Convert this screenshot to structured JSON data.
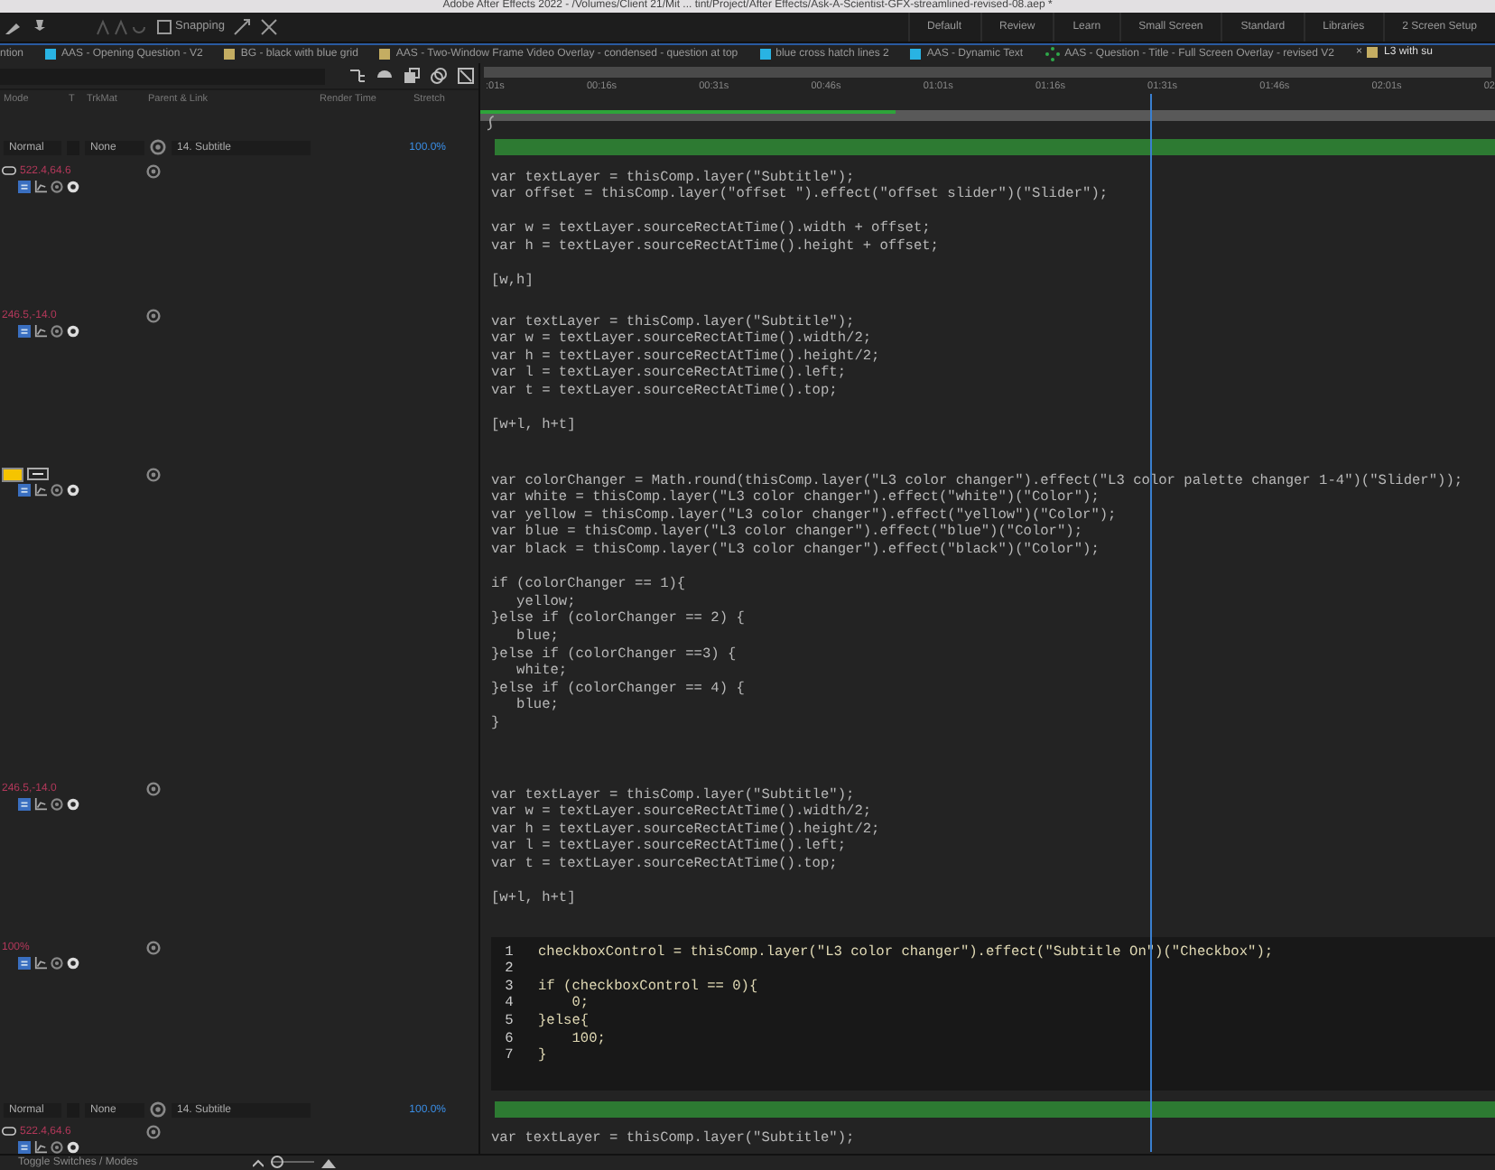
{
  "window": {
    "title": "Adobe After Effects 2022 - /Volumes/Client 21/Mit ... tint/Project/After Effects/Ask-A-Scientist-GFX-streamlined-revised-08.aep *"
  },
  "toolbar": {
    "snapping": {
      "label": "Snapping",
      "checked": false
    },
    "workspaces": [
      {
        "label": "Default",
        "selected": false
      },
      {
        "label": "Review",
        "selected": false
      },
      {
        "label": "Learn",
        "selected": false
      },
      {
        "label": "Small Screen",
        "selected": false
      },
      {
        "label": "Standard",
        "selected": false
      },
      {
        "label": "Libraries",
        "selected": false
      },
      {
        "label": "2 Screen Setup",
        "selected": false
      }
    ]
  },
  "comp_tabs": [
    {
      "label": "ntion",
      "selected": false
    },
    {
      "label": "AAS - Opening Question - V2",
      "color": "#29b3e3",
      "kind": "square",
      "selected": false
    },
    {
      "label": "BG - black with blue grid",
      "color": "#c4ad62",
      "kind": "square",
      "selected": false
    },
    {
      "label": "AAS - Two-Window Frame Video Overlay - condensed - question at top",
      "color": "#c4ad62",
      "kind": "square",
      "selected": false
    },
    {
      "label": "blue cross hatch lines 2",
      "color": "#29b3e3",
      "kind": "square",
      "selected": false
    },
    {
      "label": "AAS - Dynamic Text",
      "color": "#29b3e3",
      "kind": "square",
      "selected": false
    },
    {
      "label": "AAS - Question - Title - Full Screen Overlay - revised V2",
      "color": "#2fa84a",
      "kind": "dots",
      "selected": false
    },
    {
      "label": "L3 with su",
      "close": "×",
      "color": "#c4ad62",
      "kind": "square",
      "selected": true
    }
  ],
  "columns": [
    "Mode",
    "T",
    "TrkMat",
    "Parent & Link",
    "Render Time",
    "Stretch"
  ],
  "ruler": {
    "ticks": [
      ":01s",
      "00:16s",
      "00:31s",
      "00:46s",
      "01:01s",
      "01:16s",
      "01:31s",
      "01:46s",
      "02:01s",
      "02"
    ],
    "cache": {
      "level": 0.41
    },
    "playhead": {
      "level": 0.66
    }
  },
  "tracks": [
    {
      "kind": "marker"
    },
    {
      "kind": "layer",
      "mode": "Normal",
      "trkmat": "None",
      "parent": "14. Subtitle",
      "stretch": "100.0%"
    },
    {
      "kind": "property",
      "value": "522.4,64.6",
      "expression": "var textLayer = thisComp.layer(\"Subtitle\");\nvar offset = thisComp.layer(\"offset \").effect(\"offset slider\")(\"Slider\");\n\nvar w = textLayer.sourceRectAtTime().width + offset;\nvar h = textLayer.sourceRectAtTime().height + offset;\n\n[w,h]"
    },
    {
      "kind": "property",
      "value": "246.5,-14.0",
      "expression": "var textLayer = thisComp.layer(\"Subtitle\");\nvar w = textLayer.sourceRectAtTime().width/2;\nvar h = textLayer.sourceRectAtTime().height/2;\nvar l = textLayer.sourceRectAtTime().left;\nvar t = textLayer.sourceRectAtTime().top;\n\n[w+l, h+t]"
    },
    {
      "kind": "color",
      "color": "#f5c400",
      "expression": "var colorChanger = Math.round(thisComp.layer(\"L3 color changer\").effect(\"L3 color palette changer 1-4\")(\"Slider\"));\nvar white = thisComp.layer(\"L3 color changer\").effect(\"white\")(\"Color\");\nvar yellow = thisComp.layer(\"L3 color changer\").effect(\"yellow\")(\"Color\");\nvar blue = thisComp.layer(\"L3 color changer\").effect(\"blue\")(\"Color\");\nvar black = thisComp.layer(\"L3 color changer\").effect(\"black\")(\"Color\");\n\nif (colorChanger == 1){\n   yellow;\n}else if (colorChanger == 2) {\n   blue;\n}else if (colorChanger ==3) {\n   white;\n}else if (colorChanger == 4) {\n   blue;\n}"
    },
    {
      "kind": "property",
      "value": "246.5,-14.0",
      "expression": "var textLayer = thisComp.layer(\"Subtitle\");\nvar w = textLayer.sourceRectAtTime().width/2;\nvar h = textLayer.sourceRectAtTime().height/2;\nvar l = textLayer.sourceRectAtTime().left;\nvar t = textLayer.sourceRectAtTime().top;\n\n[w+l, h+t]"
    },
    {
      "kind": "editor",
      "value": "100%",
      "lines": [
        {
          "number": "1",
          "code": "checkboxControl = thisComp.layer(\"L3 color changer\").effect(\"Subtitle On\")(\"Checkbox\");"
        },
        {
          "number": "2"
        },
        {
          "number": "3",
          "code": "if (checkboxControl == 0){"
        },
        {
          "number": "4",
          "code": "    0;"
        },
        {
          "number": "5",
          "code": "}else{"
        },
        {
          "number": "6",
          "code": "    100;"
        },
        {
          "number": "7",
          "code": "}"
        }
      ]
    },
    {
      "kind": "layer",
      "mode": "Normal",
      "trkmat": "None",
      "parent": "14. Subtitle",
      "stretch": "100.0%"
    },
    {
      "kind": "property",
      "value": "522.4,64.6",
      "expression": "var textLayer = thisComp.layer(\"Subtitle\");"
    }
  ],
  "status_bar": {
    "label": "Toggle Switches / Modes",
    "zoom": {
      "level": 0.1
    }
  }
}
